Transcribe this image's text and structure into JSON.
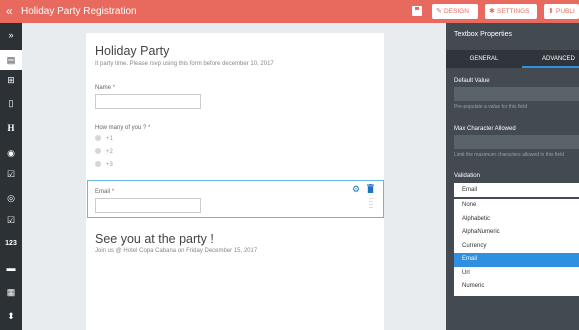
{
  "topbar": {
    "back_icon": "«",
    "title": "Holiday Party Registration",
    "design_label": "DESIGN",
    "settings_label": "SETTINGS",
    "publish_label": "PUBLI",
    "accent": "#e8695d"
  },
  "left_toolbar": {
    "items": [
      {
        "icon": "»",
        "name": "expand-icon"
      },
      {
        "icon": "▤",
        "name": "textbox-icon"
      },
      {
        "icon": "⊞",
        "name": "input-field-icon"
      },
      {
        "icon": "▯",
        "name": "textarea-icon"
      },
      {
        "icon": "H",
        "name": "heading-icon"
      },
      {
        "icon": "◉",
        "name": "select-icon"
      },
      {
        "icon": "☑",
        "name": "checkbox-icon"
      },
      {
        "icon": "◎",
        "name": "radio-icon"
      },
      {
        "icon": "☑",
        "name": "multi-check-icon"
      },
      {
        "icon": "123",
        "name": "number-icon"
      },
      {
        "icon": "▬",
        "name": "divider-icon"
      },
      {
        "icon": "▦",
        "name": "calendar-icon"
      },
      {
        "icon": "⬍",
        "name": "sort-icon"
      }
    ]
  },
  "form": {
    "title": "Holiday Party",
    "description": "It party time. Please rsvp using this form before december 10, 2017",
    "name_label": "Name",
    "count_label": "How many of you ?",
    "radio_options": [
      "+1",
      "+2",
      "+3"
    ],
    "email_label": "Email",
    "required_mark": "*",
    "thanks_title": "See you at the party !",
    "thanks_desc": "Join us @ Hotel Copa Cabana on Friday December 15, 2017"
  },
  "panel": {
    "title": "Textbox Properties",
    "tab_general": "GENERAL",
    "tab_advanced": "ADVANCED",
    "default_value_label": "Default Value",
    "default_value_help": "Pre-populate a value for this field",
    "max_char_label": "Max Character Allowed",
    "max_char_help": "Limit the maximum characters allowed in this field",
    "validation_label": "Validation",
    "validation_selected": "Email",
    "validation_options": [
      "None",
      "Alphabetic",
      "AlphaNumeric",
      "Currency",
      "Email",
      "Url",
      "Numeric"
    ]
  }
}
